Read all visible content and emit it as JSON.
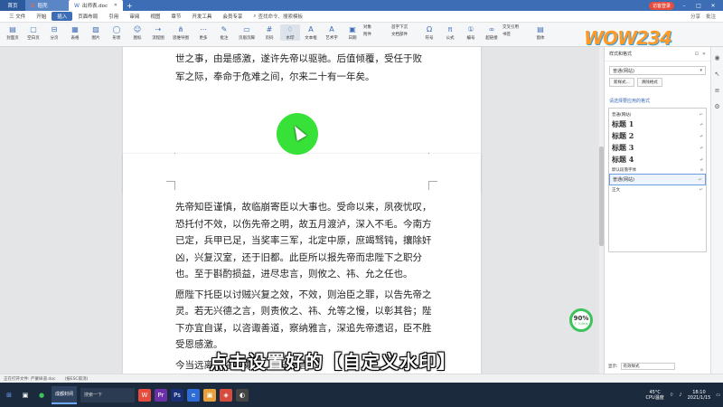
{
  "tabbar": {
    "home": "首页",
    "doc_tab": "稻壳",
    "active_tab": "出师表.doc",
    "login": "访客登录"
  },
  "menubar": {
    "file": "三 文件",
    "items": [
      "开始",
      "插入",
      "页面布局",
      "引用",
      "审阅",
      "视图",
      "章节",
      "开发工具",
      "会员专享"
    ],
    "active": "插入",
    "search": "查找命令、搜索模板",
    "right_items": [
      "分享",
      "批注"
    ]
  },
  "ribbon": {
    "buttons": [
      "封面页",
      "空白页",
      "分页",
      "表格",
      "图片",
      "形状",
      "图标",
      "流程图",
      "思维导图",
      "更多",
      "批注",
      "页眉页脚",
      "页码",
      "水印",
      "文本框",
      "艺术字",
      "日期",
      "附件",
      "文档部件",
      "符号",
      "公式",
      "编号",
      "超链接",
      "书签",
      "交叉引用",
      "窗体"
    ],
    "small": [
      "对象",
      "首字下沉",
      "文档部件"
    ]
  },
  "doc": {
    "page1_lines": [
      "世之事，由是感激，遂许先帝以驱驰。后值倾覆，受任于败",
      "军之际，奉命于危难之间，尔来二十有一年矣。"
    ],
    "page2_paras": [
      "先帝知臣谨慎，故临崩寄臣以大事也。受命以来，夙夜忧叹，恐托付不效，以伤先帝之明，故五月渡泸，深入不毛。今南方已定，兵甲已足，当奖率三军，北定中原，庶竭驽钝，攘除奸凶，兴复汉室，还于旧都。此臣所以报先帝而忠陛下之职分也。至于斟酌损益，进尽忠言，则攸之、祎、允之任也。",
      "愿陛下托臣以讨贼兴复之效，不效，则治臣之罪，以告先帝之灵。若无兴德之言，则责攸之、祎、允等之慢，以彰其咎；陛下亦宜自谋，以咨诹善道，察纳雅言，深追先帝遗诏，臣不胜受恩感激。",
      "今当远离，临表涕零，不知所言。"
    ]
  },
  "caption": "点击设置好的【自定义水印】",
  "progress": {
    "value": "90%",
    "sub": "↑ 0.4K/s"
  },
  "panel": {
    "title": "样式和格式",
    "current_style": "普通(网站)",
    "new_style": "新样式...",
    "clear_format": "清除格式",
    "apply_label": "请选择要应用的格式",
    "styles": [
      {
        "name": "普通(网站)",
        "type": "sm"
      },
      {
        "name": "标题 1",
        "type": "h"
      },
      {
        "name": "标题 2",
        "type": "h"
      },
      {
        "name": "标题 3",
        "type": "h"
      },
      {
        "name": "标题 4",
        "type": "h"
      },
      {
        "name": "默认段落字体",
        "type": "sm"
      },
      {
        "name": "普通(网站)",
        "type": "sel"
      },
      {
        "name": "正文",
        "type": "sm"
      }
    ],
    "show_label": "显示:",
    "show_value": "有效样式"
  },
  "logo": "WOW234",
  "statusbar": {
    "left": [
      "正在打开文件: 严蒙纵道.doc",
      "(按ESC取消)"
    ]
  },
  "taskbar": {
    "search": "搜索一下",
    "task": "成都封闭",
    "temp": "45°C",
    "temp_label": "CPU温度",
    "time": "18:10",
    "date": "2021/1/15"
  }
}
